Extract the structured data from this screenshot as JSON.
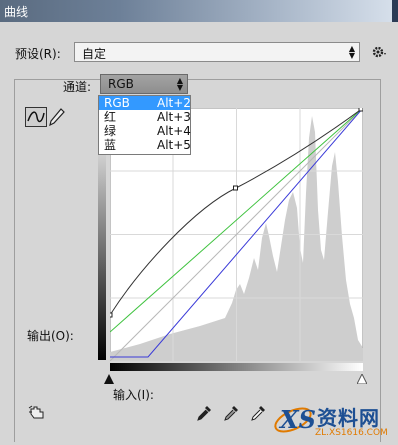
{
  "window": {
    "title": "曲线"
  },
  "preset": {
    "label": "预设(R):",
    "value": "自定"
  },
  "channel": {
    "label": "通道:",
    "value": "RGB",
    "options": [
      {
        "label": "RGB",
        "shortcut": "Alt+2",
        "selected": true
      },
      {
        "label": "红",
        "shortcut": "Alt+3",
        "selected": false
      },
      {
        "label": "绿",
        "shortcut": "Alt+4",
        "selected": false
      },
      {
        "label": "蓝",
        "shortcut": "Alt+5",
        "selected": false
      }
    ]
  },
  "graph": {
    "output_label": "输出(O):",
    "input_label": "输入(I):"
  },
  "icons": {
    "gear": "gear-icon",
    "curve_tool": "curve-tool-icon",
    "pencil": "pencil-icon",
    "hand": "hand-adjust-icon",
    "eyedropper_black": "eyedropper-black-icon",
    "eyedropper_gray": "eyedropper-gray-icon",
    "eyedropper_white": "eyedropper-white-icon"
  },
  "colors": {
    "selection": "#3399ff",
    "green_curve": "#3ec23e",
    "blue_curve": "#3a3ad8",
    "rgb_curve": "#333333"
  },
  "watermark": {
    "name": "资料网",
    "url": "ZL.XS1616.COM"
  }
}
